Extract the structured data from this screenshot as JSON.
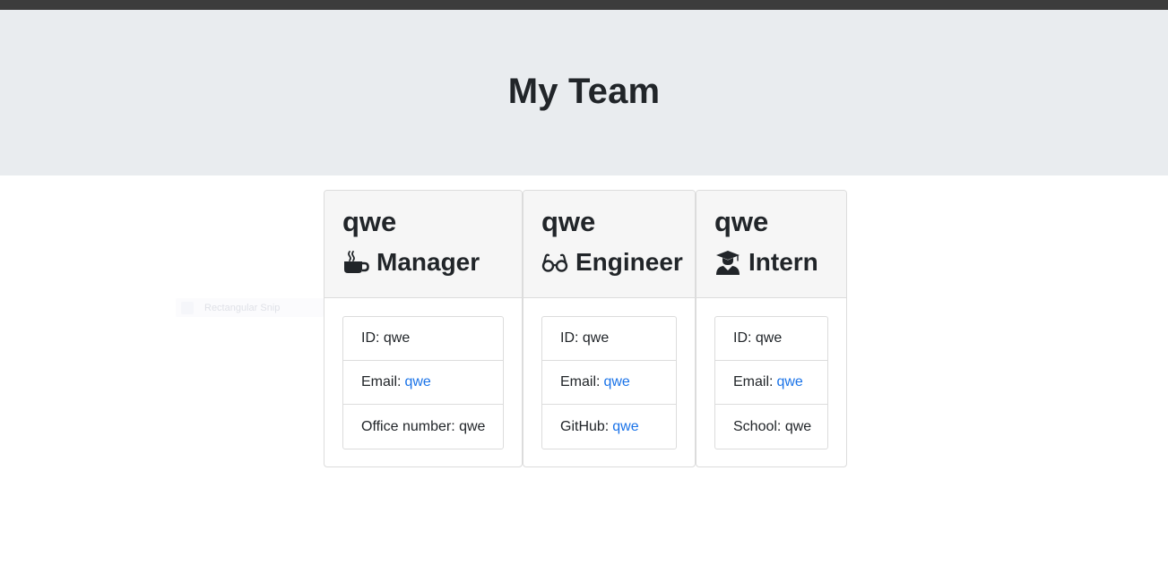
{
  "header": {
    "title": "My Team"
  },
  "ghost_item": {
    "label": "Rectangular Snip"
  },
  "cards": [
    {
      "name": "qwe",
      "role": "Manager",
      "icon": "coffee-mug-icon",
      "id_label": "ID: qwe",
      "email_label": "Email:",
      "email_value": "qwe",
      "extra_label": "Office number: qwe"
    },
    {
      "name": "qwe",
      "role": "Engineer",
      "icon": "glasses-icon",
      "id_label": "ID: qwe",
      "email_label": "Email:",
      "email_value": "qwe",
      "extra_label": "GitHub:",
      "extra_value": "qwe"
    },
    {
      "name": "qwe",
      "role": "Intern",
      "icon": "graduate-icon",
      "id_label": "ID: qwe",
      "email_label": "Email:",
      "email_value": "qwe",
      "extra_label": "School: qwe"
    }
  ],
  "colors": {
    "jumbotron_bg": "#e9ecef",
    "link": "#1a73e8",
    "card_header_bg": "#f6f6f6",
    "topbar": "#3c3c3c"
  }
}
